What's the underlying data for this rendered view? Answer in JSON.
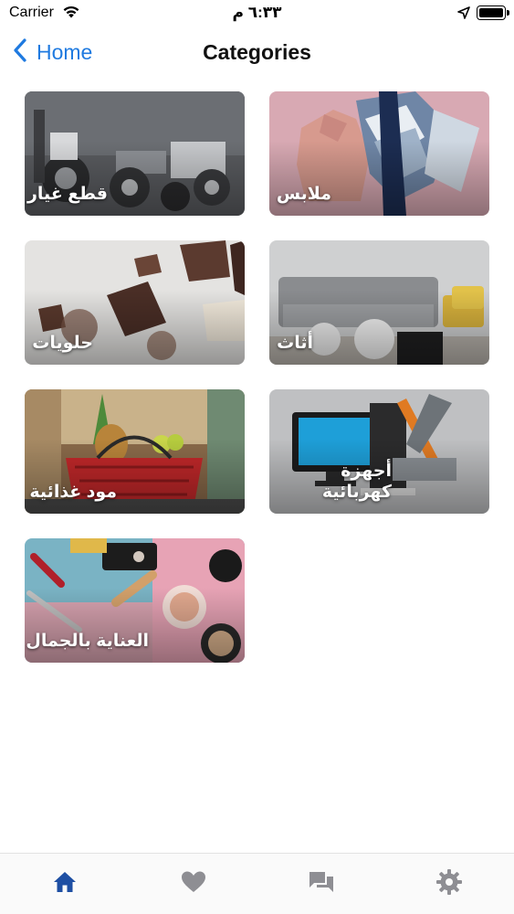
{
  "status_bar": {
    "carrier": "Carrier",
    "time": "٦:٣٣ م"
  },
  "nav": {
    "back_label": "Home",
    "title": "Categories"
  },
  "categories": [
    {
      "label": "ملابس"
    },
    {
      "label": "قطع غيار"
    },
    {
      "label": "أثاث"
    },
    {
      "label": "حلويات"
    },
    {
      "label": "أجهزة كهربائية"
    },
    {
      "label": "مود غذائية"
    },
    {
      "label": "العناية بالجمال"
    }
  ],
  "tab_bar": {
    "items": [
      {
        "icon": "home-icon",
        "active": true
      },
      {
        "icon": "heart-icon",
        "active": false
      },
      {
        "icon": "chat-icon",
        "active": false
      },
      {
        "icon": "gear-icon",
        "active": false
      }
    ],
    "active_color": "#1e4fa3",
    "inactive_color": "#8e8e93"
  },
  "colors": {
    "accent": "#1f7ae0"
  }
}
